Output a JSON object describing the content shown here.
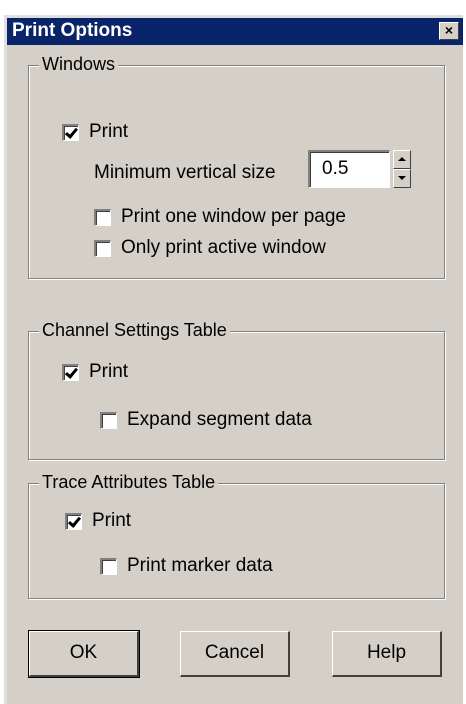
{
  "window": {
    "title": "Print Options",
    "close_glyph": "×",
    "colors": {
      "titlebar": "#0a246a",
      "face": "#d4d0c8"
    }
  },
  "windows_group": {
    "legend": "Windows",
    "print_label": "Print",
    "print_checked": true,
    "min_vertical_label": "Minimum vertical size",
    "min_vertical_value": "0.5",
    "one_per_page_label": "Print one window per page",
    "one_per_page_checked": false,
    "only_active_label": "Only print active window",
    "only_active_checked": false
  },
  "channel_group": {
    "legend": "Channel Settings Table",
    "print_label": "Print",
    "print_checked": true,
    "expand_label": "Expand segment data",
    "expand_checked": false
  },
  "trace_group": {
    "legend": "Trace Attributes Table",
    "print_label": "Print",
    "print_checked": true,
    "marker_label": "Print marker data",
    "marker_checked": false
  },
  "buttons": {
    "ok": "OK",
    "cancel": "Cancel",
    "help": "Help"
  }
}
